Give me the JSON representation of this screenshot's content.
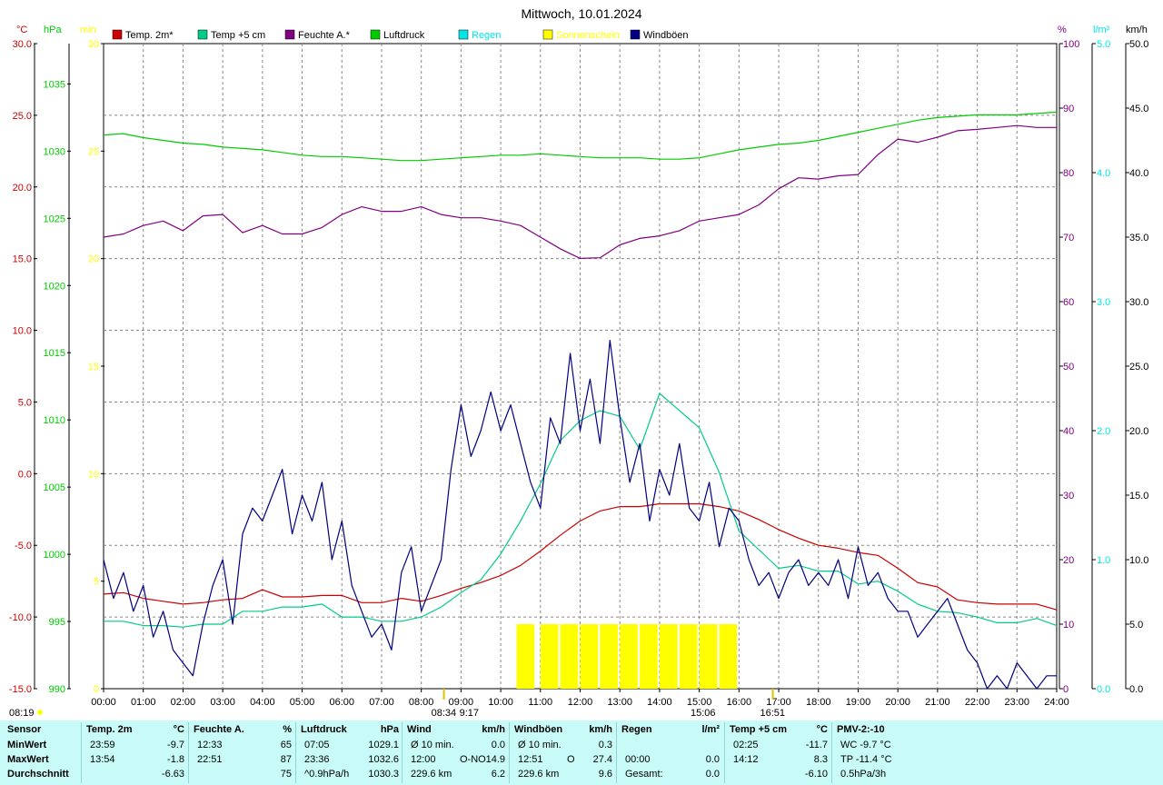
{
  "title": "Mittwoch, 10.01.2024",
  "colors": {
    "temp2m": "#cc0000",
    "temp5cm": "#00cc88",
    "humidity": "#800080",
    "pressure": "#00cc00",
    "rain": "#00e5e5",
    "sunshine": "#ffff00",
    "gusts": "#000080",
    "footer_bg": "#c8fbf8"
  },
  "axis_units": {
    "temp": "°C",
    "pressure": "hPa",
    "sun": "min",
    "humidity": "%",
    "rain": "l/m²",
    "wind": "km/h"
  },
  "legend": [
    {
      "label": "Temp. 2m*",
      "color": "#cc0000"
    },
    {
      "label": "Temp +5 cm",
      "color": "#00cc88"
    },
    {
      "label": "Feuchte A.*",
      "color": "#800080"
    },
    {
      "label": "Luftdruck",
      "color": "#00cc00"
    },
    {
      "label": "Regen",
      "color": "#00e5e5"
    },
    {
      "label": "Sonnenschein",
      "color": "#ffff00"
    },
    {
      "label": "Windböen",
      "color": "#000080"
    }
  ],
  "chart_data": {
    "type": "line",
    "title": "Mittwoch, 10.01.2024",
    "grid": true,
    "x_range": [
      0,
      24
    ],
    "x_ticks": [
      "00:00",
      "01:00",
      "02:00",
      "03:00",
      "04:00",
      "05:00",
      "06:00",
      "07:00",
      "08:00",
      "09:00",
      "10:00",
      "11:00",
      "12:00",
      "13:00",
      "14:00",
      "15:00",
      "16:00",
      "17:00",
      "18:00",
      "19:00",
      "20:00",
      "21:00",
      "22:00",
      "23:00",
      "24:00"
    ],
    "axes": {
      "temp": {
        "unit": "°C",
        "range": [
          -15,
          30
        ],
        "ticks": [
          "30.0",
          "25.0",
          "20.0",
          "15.0",
          "10.0",
          "5.0",
          "0.0",
          "-5.0",
          "-10.0",
          "-15.0"
        ]
      },
      "pressure": {
        "unit": "hPa",
        "range": [
          990,
          1038
        ],
        "ticks": [
          "1035",
          "1030",
          "1025",
          "1020",
          "1015",
          "1010",
          "1005",
          "1000",
          "995",
          "990"
        ]
      },
      "sun": {
        "unit": "min",
        "range": [
          0,
          30
        ],
        "ticks": [
          "30",
          "25",
          "20",
          "15",
          "10",
          "5",
          "0"
        ]
      },
      "humidity": {
        "unit": "%",
        "range": [
          0,
          100
        ],
        "ticks": [
          "100",
          "90",
          "80",
          "70",
          "60",
          "50",
          "40",
          "30",
          "20",
          "10",
          "0"
        ]
      },
      "rain": {
        "unit": "l/m²",
        "range": [
          0,
          5
        ],
        "ticks": [
          "5.0",
          "4.0",
          "3.0",
          "2.0",
          "1.0",
          "0.0"
        ]
      },
      "wind": {
        "unit": "km/h",
        "range": [
          0,
          50
        ],
        "ticks": [
          "50.0",
          "45.0",
          "40.0",
          "35.0",
          "30.0",
          "25.0",
          "20.0",
          "15.0",
          "10.0",
          "5.0",
          "0.0"
        ]
      }
    },
    "series": [
      {
        "name": "Temp. 2m*",
        "axis": "temp",
        "x": [
          0,
          0.5,
          1,
          1.5,
          2,
          2.5,
          3,
          3.5,
          4,
          4.5,
          5,
          5.5,
          6,
          6.5,
          7,
          7.5,
          8,
          8.5,
          9,
          9.5,
          10,
          10.5,
          11,
          11.5,
          12,
          12.5,
          13,
          13.5,
          14,
          14.5,
          15,
          15.5,
          16,
          16.5,
          17,
          17.5,
          18,
          18.5,
          19,
          19.5,
          20,
          20.5,
          21,
          21.5,
          22,
          22.5,
          23,
          23.5,
          24
        ],
        "y": [
          -8.4,
          -8.3,
          -8.7,
          -8.9,
          -9.1,
          -9.0,
          -8.8,
          -8.7,
          -8.1,
          -8.6,
          -8.6,
          -8.5,
          -8.5,
          -9.0,
          -9.0,
          -8.7,
          -8.9,
          -8.5,
          -8.0,
          -7.6,
          -7.1,
          -6.4,
          -5.4,
          -4.3,
          -3.3,
          -2.6,
          -2.3,
          -2.3,
          -2.1,
          -2.1,
          -2.1,
          -2.3,
          -2.6,
          -3.2,
          -3.9,
          -4.5,
          -5.0,
          -5.2,
          -5.5,
          -5.7,
          -6.6,
          -7.6,
          -7.9,
          -8.8,
          -9.0,
          -9.1,
          -9.1,
          -9.1,
          -9.5
        ]
      },
      {
        "name": "Temp +5 cm",
        "axis": "temp",
        "x": [
          0,
          0.5,
          1,
          1.5,
          2,
          2.5,
          3,
          3.5,
          4,
          4.5,
          5,
          5.5,
          6,
          6.5,
          7,
          7.5,
          8,
          8.5,
          9,
          9.5,
          10,
          10.5,
          11,
          11.5,
          12,
          12.5,
          13,
          13.5,
          14,
          14.5,
          15,
          15.5,
          16,
          16.5,
          17,
          17.5,
          18,
          18.5,
          19,
          19.5,
          20,
          20.5,
          21,
          21.5,
          22,
          22.5,
          23,
          23.5,
          24
        ],
        "y": [
          -10.3,
          -10.3,
          -10.6,
          -10.6,
          -10.7,
          -10.5,
          -10.5,
          -9.6,
          -9.6,
          -9.3,
          -9.3,
          -9.1,
          -10.0,
          -10.0,
          -10.3,
          -10.3,
          -10.0,
          -9.3,
          -8.3,
          -7.4,
          -5.6,
          -3.3,
          -0.7,
          2.3,
          3.7,
          4.4,
          4.0,
          1.7,
          5.6,
          4.4,
          3.2,
          0.1,
          -4.0,
          -5.3,
          -6.6,
          -6.4,
          -6.8,
          -6.8,
          -7.7,
          -7.5,
          -8.2,
          -9.1,
          -9.6,
          -9.7,
          -10.0,
          -10.4,
          -10.4,
          -10.1,
          -10.6
        ]
      },
      {
        "name": "Feuchte A.*",
        "axis": "humidity",
        "x": [
          0,
          0.5,
          1,
          1.5,
          2,
          2.5,
          3,
          3.5,
          4,
          4.5,
          5,
          5.5,
          6,
          6.5,
          7,
          7.5,
          8,
          8.5,
          9,
          9.5,
          10,
          10.5,
          11,
          11.5,
          12,
          12.5,
          13,
          13.5,
          14,
          14.5,
          15,
          15.5,
          16,
          16.5,
          17,
          17.5,
          18,
          18.5,
          19,
          19.5,
          20,
          20.5,
          21,
          21.5,
          22,
          22.5,
          23,
          23.5,
          24
        ],
        "y": [
          70.0,
          70.5,
          71.8,
          72.5,
          71.0,
          73.3,
          73.5,
          70.7,
          71.8,
          70.5,
          70.5,
          71.5,
          73.5,
          74.7,
          74.0,
          74.0,
          74.7,
          73.5,
          73.0,
          73.0,
          72.5,
          71.8,
          70.0,
          68.2,
          66.7,
          66.8,
          68.8,
          69.8,
          70.2,
          71.0,
          72.5,
          73.0,
          73.5,
          75.0,
          77.5,
          79.2,
          79.0,
          79.5,
          79.7,
          82.8,
          85.2,
          84.7,
          85.5,
          86.5,
          86.7,
          87.0,
          87.3,
          87.0,
          87.0
        ]
      },
      {
        "name": "Luftdruck",
        "axis": "pressure",
        "x": [
          0,
          0.5,
          1,
          1.5,
          2,
          2.5,
          3,
          3.5,
          4,
          4.5,
          5,
          5.5,
          6,
          6.5,
          7,
          7.5,
          8,
          8.5,
          9,
          9.5,
          10,
          10.5,
          11,
          11.5,
          12,
          12.5,
          13,
          13.5,
          14,
          14.5,
          15,
          15.5,
          16,
          16.5,
          17,
          17.5,
          18,
          18.5,
          19,
          19.5,
          20,
          20.5,
          21,
          21.5,
          22,
          22.5,
          23,
          23.5,
          24
        ],
        "y": [
          1031.2,
          1031.3,
          1031.0,
          1030.8,
          1030.6,
          1030.5,
          1030.3,
          1030.2,
          1030.1,
          1029.9,
          1029.7,
          1029.6,
          1029.6,
          1029.5,
          1029.4,
          1029.3,
          1029.3,
          1029.4,
          1029.5,
          1029.6,
          1029.7,
          1029.7,
          1029.8,
          1029.7,
          1029.6,
          1029.5,
          1029.5,
          1029.5,
          1029.4,
          1029.4,
          1029.5,
          1029.8,
          1030.1,
          1030.3,
          1030.5,
          1030.6,
          1030.8,
          1031.1,
          1031.4,
          1031.7,
          1032.0,
          1032.3,
          1032.5,
          1032.6,
          1032.7,
          1032.7,
          1032.7,
          1032.8,
          1032.9
        ]
      },
      {
        "name": "Windböen",
        "axis": "wind",
        "x": [
          0,
          0.25,
          0.5,
          0.75,
          1,
          1.25,
          1.5,
          1.75,
          2,
          2.25,
          2.5,
          2.75,
          3,
          3.25,
          3.5,
          3.75,
          4,
          4.25,
          4.5,
          4.75,
          5,
          5.25,
          5.5,
          5.75,
          6,
          6.25,
          6.5,
          6.75,
          7,
          7.25,
          7.5,
          7.75,
          8,
          8.25,
          8.5,
          8.75,
          9,
          9.25,
          9.5,
          9.75,
          10,
          10.25,
          10.5,
          10.75,
          11,
          11.25,
          11.5,
          11.75,
          12,
          12.25,
          12.5,
          12.75,
          13,
          13.25,
          13.5,
          13.75,
          14,
          14.25,
          14.5,
          14.75,
          15,
          15.25,
          15.5,
          15.75,
          16,
          16.25,
          16.5,
          16.75,
          17,
          17.25,
          17.5,
          17.75,
          18,
          18.25,
          18.5,
          18.75,
          19,
          19.25,
          19.5,
          19.75,
          20,
          20.25,
          20.5,
          20.75,
          21,
          21.25,
          21.5,
          21.75,
          22,
          22.25,
          22.5,
          22.75,
          23,
          23.25,
          23.5,
          23.75,
          24
        ],
        "y": [
          10.0,
          7.0,
          9.0,
          6.0,
          8.0,
          4.0,
          6.0,
          3.0,
          2.0,
          1.0,
          5.0,
          8.0,
          10.0,
          5.0,
          12.0,
          14.0,
          13.0,
          15.0,
          17.0,
          12.0,
          15.0,
          13.0,
          16.0,
          10.0,
          13.0,
          8.0,
          6.0,
          4.0,
          5.0,
          3.0,
          9.0,
          11.0,
          6.0,
          8.0,
          10.0,
          17.0,
          22.0,
          18.0,
          20.0,
          23.0,
          20.0,
          22.0,
          19.0,
          16.0,
          14.0,
          21.0,
          19.0,
          26.0,
          20.0,
          24.0,
          19.0,
          27.0,
          21.0,
          16.0,
          19.0,
          13.0,
          17.0,
          15.0,
          19.0,
          14.0,
          13.0,
          16.0,
          11.0,
          14.0,
          13.0,
          10.0,
          8.0,
          9.0,
          7.0,
          9.0,
          10.0,
          8.0,
          9.0,
          8.0,
          10.0,
          7.0,
          11.0,
          8.0,
          9.0,
          7.0,
          6.0,
          6.0,
          4.0,
          5.0,
          6.0,
          7.0,
          5.0,
          3.0,
          2.0,
          0.0,
          1.0,
          0.0,
          2.0,
          1.0,
          0.0,
          1.0,
          1.0
        ]
      },
      {
        "name": "Sonnenschein",
        "axis": "sun",
        "type": "bar",
        "x": [
          10.4,
          11.0,
          11.5,
          12.0,
          12.5,
          13.0,
          13.5,
          14.0,
          14.5,
          15.0,
          15.5
        ],
        "y": [
          3,
          3,
          3,
          3,
          3,
          3,
          3,
          3,
          3,
          3,
          3
        ]
      }
    ],
    "annotations": [
      {
        "text": "08:19",
        "x": 0
      },
      {
        "text": "08:34",
        "x": 8.57
      },
      {
        "text": "9:17",
        "x": 9.28
      },
      {
        "text": "15:06",
        "x": 15.1
      },
      {
        "text": "16:51",
        "x": 16.85
      }
    ]
  },
  "footer": {
    "row_labels": [
      "Sensor",
      "MinWert",
      "MaxWert",
      "Durchschnitt"
    ],
    "groups": [
      {
        "name": "Temp. 2m",
        "unit": "°C",
        "rows": [
          [
            "23:59",
            "",
            "-9.7"
          ],
          [
            "13:54",
            "",
            "-1.8"
          ],
          [
            "",
            "",
            "-6.63"
          ]
        ]
      },
      {
        "name": "Feuchte A.",
        "unit": "%",
        "rows": [
          [
            "12:33",
            "",
            "65"
          ],
          [
            "22:51",
            "",
            "87"
          ],
          [
            "",
            "",
            "75"
          ]
        ]
      },
      {
        "name": "Luftdruck",
        "unit": "hPa",
        "rows": [
          [
            "07:05",
            "",
            "1029.1"
          ],
          [
            "23:36",
            "",
            "1032.6"
          ],
          [
            "^0.9hPa/h",
            "",
            "1030.3"
          ]
        ]
      },
      {
        "name": "Wind",
        "unit": "km/h",
        "rows": [
          [
            "Ø 10 min.",
            "",
            "0.0"
          ],
          [
            "12:00",
            "O-NO",
            "14.9"
          ],
          [
            "229.6 km",
            "",
            "6.2"
          ]
        ]
      },
      {
        "name": "Windböen",
        "unit": "km/h",
        "rows": [
          [
            "Ø 10 min.",
            "",
            "0.3"
          ],
          [
            "12:51",
            "O",
            "27.4"
          ],
          [
            "229.6 km",
            "",
            "9.6"
          ]
        ]
      },
      {
        "name": "Regen",
        "unit": "l/m²",
        "rows": [
          [
            "",
            "",
            ""
          ],
          [
            "00:00",
            "",
            "0.0"
          ],
          [
            "Gesamt:",
            "",
            "0.0"
          ]
        ]
      },
      {
        "name": "Temp +5 cm",
        "unit": "°C",
        "rows": [
          [
            "02:25",
            "",
            "-11.7"
          ],
          [
            "14:12",
            "",
            "8.3"
          ],
          [
            "",
            "",
            "-6.10"
          ]
        ]
      },
      {
        "name": "PMV-2:-10",
        "unit": "",
        "rows": [
          [
            "WC -9.7 °C",
            "",
            ""
          ],
          [
            "TP -11.4 °C",
            "",
            ""
          ],
          [
            "0.5hPa/3h",
            "",
            ""
          ]
        ]
      }
    ]
  }
}
